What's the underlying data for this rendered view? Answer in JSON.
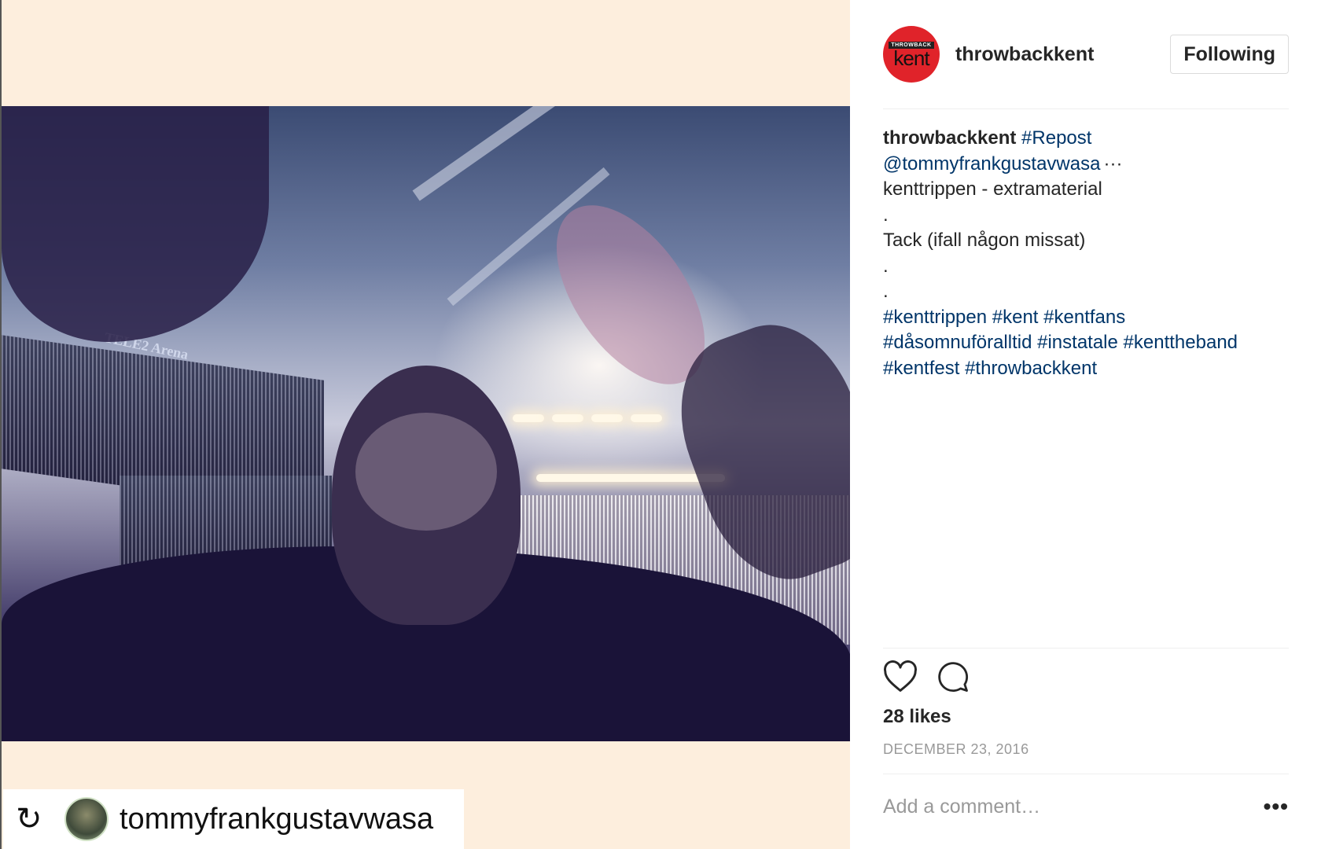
{
  "post": {
    "username": "throwbackkent",
    "follow_label": "Following",
    "avatar_text_top": "THROWBACK",
    "avatar_text_bottom": "kent",
    "caption": {
      "repost_tag": "#Repost",
      "mention": "@tommyfrankgustavwasa",
      "more": "···",
      "line2": "kenttrippen - extramaterial",
      "dot1": ".",
      "line4": "Tack (ifall någon missat)",
      "dot2": ".",
      "dot3": ".",
      "hashtags": [
        [
          "#kenttrippen",
          "#kent",
          "#kentfans"
        ],
        [
          "#dåsomnuföralltid",
          "#instatale",
          "#kenttheband"
        ],
        [
          "#kentfest",
          "#throwbackkent"
        ]
      ]
    },
    "likes": "28 likes",
    "date": "DECEMBER 23, 2016",
    "comment_placeholder": "Add a comment…",
    "options_label": "•••",
    "icons": [
      "heart-icon",
      "comment-icon",
      "repost-icon"
    ]
  },
  "repost_badge": {
    "icon": "↻",
    "username": "tommyfrankgustavwasa"
  },
  "photo_signage": "TELE2 Arena"
}
